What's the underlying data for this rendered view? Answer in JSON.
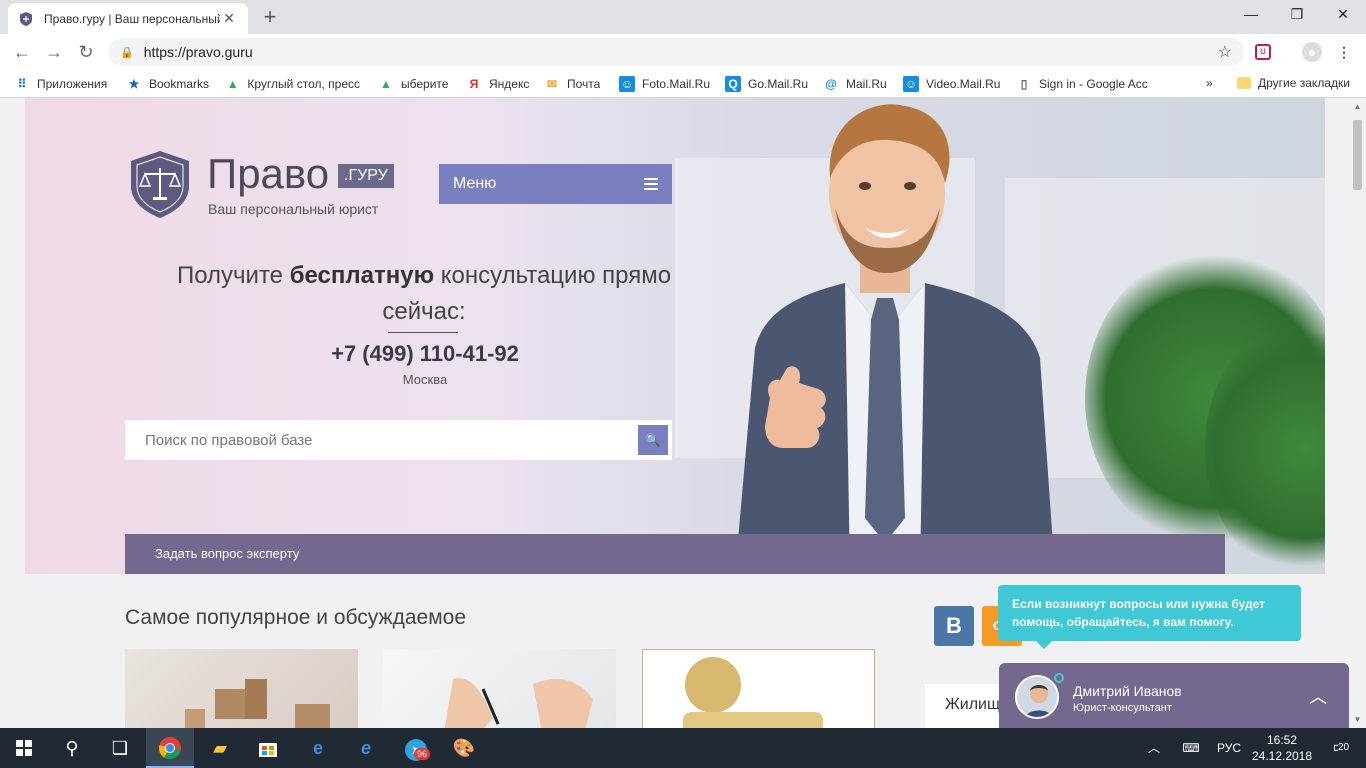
{
  "browser": {
    "tab_title": "Право.гуру | Ваш персональный",
    "url": "https://pravo.guru",
    "bookmarks": [
      {
        "label": "Приложения",
        "icon": "apps-grid-icon"
      },
      {
        "label": "Bookmarks",
        "icon": "star-icon"
      },
      {
        "label": "Круглый стол, пресс",
        "icon": "google-drive-icon"
      },
      {
        "label": "ыберите",
        "icon": "google-drive-icon"
      },
      {
        "label": "Яндекс",
        "icon": "yandex-icon"
      },
      {
        "label": "Почта",
        "icon": "mail-icon"
      },
      {
        "label": "Foto.Mail.Ru",
        "icon": "mailru-icon"
      },
      {
        "label": "Go.Mail.Ru",
        "icon": "search-icon"
      },
      {
        "label": "Mail.Ru",
        "icon": "at-icon"
      },
      {
        "label": "Video.Mail.Ru",
        "icon": "mailru-icon"
      },
      {
        "label": "Sign in - Google Acc",
        "icon": "page-icon"
      }
    ],
    "more_bookmarks": "»",
    "other_bookmarks": "Другие закладки"
  },
  "site": {
    "brand": "Право",
    "brand_badge": ".ГУРУ",
    "tagline": "Ваш персональный юрист",
    "menu_label": "Меню",
    "headline_pre": "Получите",
    "headline_bold": "бесплатную",
    "headline_post": "консультацию прямо сейчас:",
    "phone": "+7 (499) 110-41-92",
    "city": "Москва",
    "search_placeholder": "Поиск по правовой базе",
    "ask_expert": "Задать вопрос эксперту",
    "section_title": "Самое популярное и обсуждаемое",
    "side_widget_label": "Жилищ",
    "social": [
      {
        "label": "В",
        "color": "#4a76a8"
      },
      {
        "label": "ok",
        "color": "#f59a23"
      }
    ]
  },
  "chat": {
    "tooltip": "Если возникнут вопросы или нужна будет помощь, обращайтесь, я вам помогу.",
    "name": "Дмитрий Иванов",
    "role": "Юрист-консультант"
  },
  "taskbar": {
    "lang": "РУС",
    "time": "16:52",
    "date": "24.12.2018",
    "notifications": "20",
    "telegram_badge": "96"
  },
  "colors": {
    "accent": "#7a7fbf",
    "bar": "#75688f",
    "tooltip": "#3fc8d6"
  }
}
